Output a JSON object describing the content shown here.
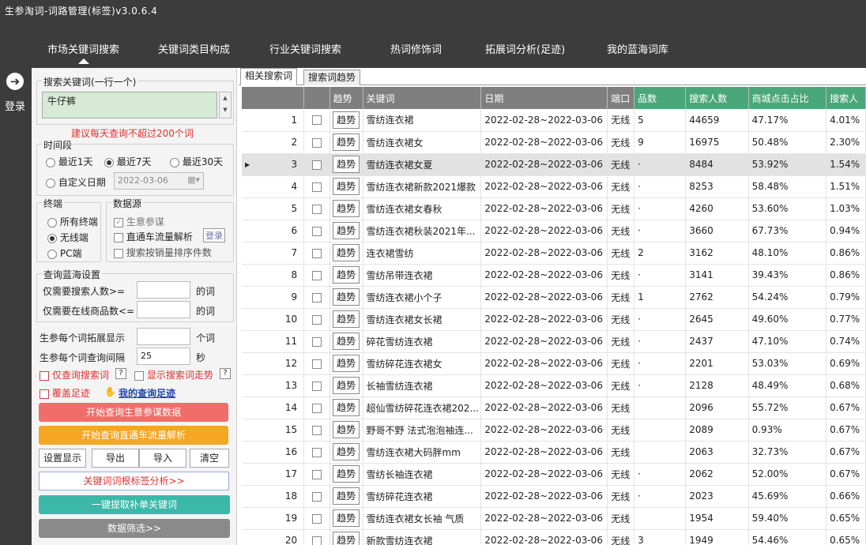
{
  "app": {
    "title": "生参淘词-词路管理(标签)v3.0.6.4"
  },
  "nav": {
    "tabs": [
      "市场关键词搜索",
      "关键词类目构成",
      "行业关键词搜索",
      "热词修饰词",
      "拓展词分析(足迹)",
      "我的蓝海词库"
    ],
    "active": 0
  },
  "sidebar": {
    "login_label": "登录"
  },
  "panel": {
    "keywords_label": "搜索关键词(一行一个)",
    "keywords_value": "牛仔裤",
    "hint": "建议每天查询不超过200个词",
    "period": {
      "label": "时间段",
      "opt1": "最近1天",
      "opt7": "最近7天",
      "opt30": "最近30天",
      "custom": "自定义日期",
      "date": "2022-03-06",
      "selected": "最近7天"
    },
    "terminal": {
      "label": "终端",
      "all": "所有终端",
      "wireless": "无线端",
      "pc": "PC端",
      "selected": "无线端"
    },
    "source": {
      "label": "数据源",
      "opt1": "生意参谋",
      "opt2": "直通车流量解析",
      "login": "登录",
      "opt3": "搜索按销量排序件数"
    },
    "bluesea": {
      "label": "查询蓝海设置",
      "search_label": "仅需要搜索人数>=",
      "search_unit": "的词",
      "goods_label": "仅需要在线商品数<=",
      "goods_unit": "的词"
    },
    "expand": {
      "label": "生参每个词拓展显示",
      "unit": "个词",
      "value": ""
    },
    "interval": {
      "label": "生参每个词查询间隔",
      "value": "25",
      "unit": "秒"
    },
    "only_search": "仅查询搜索词",
    "show_trend": "显示搜索词走势",
    "q": "?",
    "cover": "覆盖足迹",
    "my_footprint": "我的查询足迹",
    "btn_start": "开始查询生意参谋数据",
    "btn_start_color": "#f06e6a",
    "btn_ztc": "开始查询直通车流量解析",
    "btn_ztc_color": "#f5a623",
    "btn_settings": "设置显示",
    "btn_export": "导出",
    "btn_import": "导入",
    "btn_clear": "清空",
    "btn_root": "关键词词根标签分析>>",
    "btn_extract": "一键提取补单关键词",
    "btn_extract_color": "#3bb8a8",
    "btn_filter": "数据筛选>>"
  },
  "main": {
    "tabs": [
      "相关搜索词",
      "搜索词趋势"
    ],
    "columns": [
      "趋势",
      "关键词",
      "日期",
      "端口",
      "品数",
      "搜索人数",
      "商城点击占比",
      "搜索人"
    ],
    "trend_label": "趋势",
    "rows": [
      {
        "n": "1",
        "kw": "雪纺连衣裙",
        "date": "2022-02-28~2022-03-06",
        "port": "无线",
        "goods": "5",
        "search": "44659",
        "mall": "47.17%",
        "share": "4.01%"
      },
      {
        "n": "2",
        "kw": "雪纺连衣裙女",
        "date": "2022-02-28~2022-03-06",
        "port": "无线",
        "goods": "9",
        "search": "16975",
        "mall": "50.48%",
        "share": "2.30%"
      },
      {
        "n": "3",
        "kw": "雪纺连衣裙女夏",
        "date": "2022-02-28~2022-03-06",
        "port": "无线",
        "goods": "·",
        "search": "8484",
        "mall": "53.92%",
        "share": "1.54%"
      },
      {
        "n": "4",
        "kw": "雪纺连衣裙新款2021爆款",
        "date": "2022-02-28~2022-03-06",
        "port": "无线",
        "goods": "·",
        "search": "8253",
        "mall": "58.48%",
        "share": "1.51%"
      },
      {
        "n": "5",
        "kw": "雪纺连衣裙女春秋",
        "date": "2022-02-28~2022-03-06",
        "port": "无线",
        "goods": "·",
        "search": "4260",
        "mall": "53.60%",
        "share": "1.03%"
      },
      {
        "n": "6",
        "kw": "雪纺连衣裙秋装2021年...",
        "date": "2022-02-28~2022-03-06",
        "port": "无线",
        "goods": "·",
        "search": "3660",
        "mall": "67.73%",
        "share": "0.94%"
      },
      {
        "n": "7",
        "kw": "连衣裙雪纺",
        "date": "2022-02-28~2022-03-06",
        "port": "无线",
        "goods": "2",
        "search": "3162",
        "mall": "48.10%",
        "share": "0.86%"
      },
      {
        "n": "8",
        "kw": "雪纺吊带连衣裙",
        "date": "2022-02-28~2022-03-06",
        "port": "无线",
        "goods": "·",
        "search": "3141",
        "mall": "39.43%",
        "share": "0.86%"
      },
      {
        "n": "9",
        "kw": "雪纺连衣裙小个子",
        "date": "2022-02-28~2022-03-06",
        "port": "无线",
        "goods": "1",
        "search": "2762",
        "mall": "54.24%",
        "share": "0.79%"
      },
      {
        "n": "10",
        "kw": "雪纺连衣裙女长裙",
        "date": "2022-02-28~2022-03-06",
        "port": "无线",
        "goods": "·",
        "search": "2645",
        "mall": "49.60%",
        "share": "0.77%"
      },
      {
        "n": "11",
        "kw": "碎花雪纺连衣裙",
        "date": "2022-02-28~2022-03-06",
        "port": "无线",
        "goods": "·",
        "search": "2437",
        "mall": "47.10%",
        "share": "0.74%"
      },
      {
        "n": "12",
        "kw": "雪纺碎花连衣裙女",
        "date": "2022-02-28~2022-03-06",
        "port": "无线",
        "goods": "·",
        "search": "2201",
        "mall": "53.03%",
        "share": "0.69%"
      },
      {
        "n": "13",
        "kw": "长袖雪纺连衣裙",
        "date": "2022-02-28~2022-03-06",
        "port": "无线",
        "goods": "·",
        "search": "2128",
        "mall": "48.49%",
        "share": "0.68%"
      },
      {
        "n": "14",
        "kw": "超仙雪纺碎花连衣裙202...",
        "date": "2022-02-28~2022-03-06",
        "port": "无线",
        "goods": "",
        "search": "2096",
        "mall": "55.72%",
        "share": "0.67%"
      },
      {
        "n": "15",
        "kw": "野哥不野 法式泡泡袖连...",
        "date": "2022-02-28~2022-03-06",
        "port": "无线",
        "goods": "",
        "search": "2089",
        "mall": "0.93%",
        "share": "0.67%"
      },
      {
        "n": "16",
        "kw": "雪纺连衣裙大码胖mm",
        "date": "2022-02-28~2022-03-06",
        "port": "无线",
        "goods": "",
        "search": "2063",
        "mall": "32.73%",
        "share": "0.67%"
      },
      {
        "n": "17",
        "kw": "雪纺长袖连衣裙",
        "date": "2022-02-28~2022-03-06",
        "port": "无线",
        "goods": "·",
        "search": "2062",
        "mall": "52.00%",
        "share": "0.67%"
      },
      {
        "n": "18",
        "kw": "雪纺碎花连衣裙",
        "date": "2022-02-28~2022-03-06",
        "port": "无线",
        "goods": "·",
        "search": "2023",
        "mall": "45.69%",
        "share": "0.66%"
      },
      {
        "n": "19",
        "kw": "雪纺连衣裙女长袖 气质",
        "date": "2022-02-28~2022-03-06",
        "port": "无线",
        "goods": "",
        "search": "1954",
        "mall": "59.40%",
        "share": "0.65%"
      },
      {
        "n": "20",
        "kw": "新款雪纺连衣裙",
        "date": "2022-02-28~2022-03-06",
        "port": "无线",
        "goods": "3",
        "search": "1949",
        "mall": "54.46%",
        "share": "0.65%"
      }
    ],
    "selected_row": 2
  }
}
